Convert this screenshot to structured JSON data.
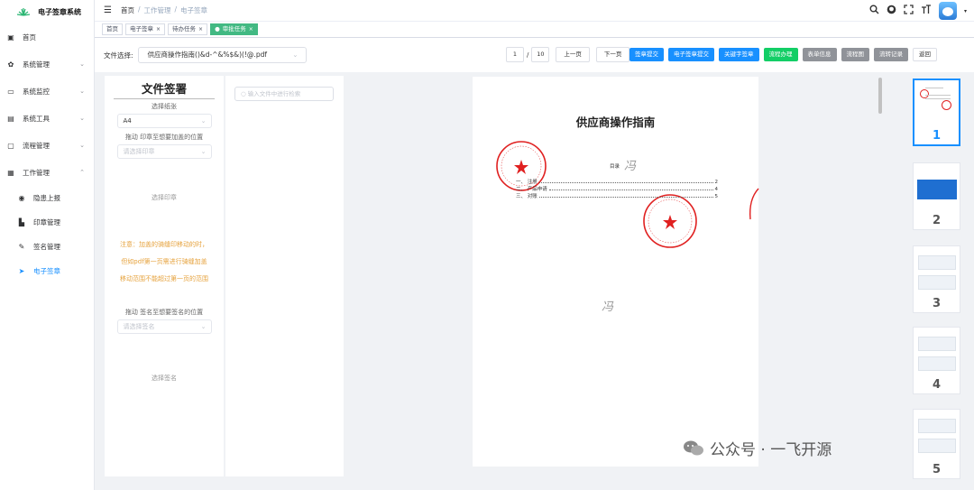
{
  "sidebar": {
    "brand": "电子签章系统",
    "items": [
      {
        "label": "首页",
        "icon": "dashboard-icon"
      },
      {
        "label": "系统管理",
        "icon": "gear-icon",
        "arrow": "⌄"
      },
      {
        "label": "系统监控",
        "icon": "monitor-icon",
        "arrow": "⌄"
      },
      {
        "label": "系统工具",
        "icon": "tool-icon",
        "arrow": "⌄"
      },
      {
        "label": "流程管理",
        "icon": "flow-icon",
        "arrow": "⌄"
      },
      {
        "label": "工作管理",
        "icon": "work-icon",
        "arrow": "⌃"
      }
    ],
    "subitems": [
      {
        "label": "隐患上报",
        "icon": "report-icon"
      },
      {
        "label": "印章管理",
        "icon": "seal-icon"
      },
      {
        "label": "签名管理",
        "icon": "signature-icon"
      },
      {
        "label": "电子签章",
        "icon": "send-icon",
        "active": true
      }
    ]
  },
  "header": {
    "breadcrumb": [
      "首页",
      "/",
      "工作管理",
      "/",
      "电子签章"
    ]
  },
  "tags": [
    {
      "label": "首页",
      "active": false,
      "closable": false
    },
    {
      "label": "电子签章",
      "active": false,
      "closable": true
    },
    {
      "label": "待办任务",
      "active": false,
      "closable": true
    },
    {
      "label": "审批任务",
      "active": true,
      "closable": true
    }
  ],
  "toolbar": {
    "file_label": "文件选择:",
    "file_value": "供应商操作指南()&d-^&%$&)(!@.pdf",
    "page_current": "1",
    "page_sep": "/",
    "page_total": "10",
    "prev": "上一页",
    "next": "下一页",
    "buttons": [
      {
        "label": "签章提交",
        "style": "blue"
      },
      {
        "label": "电子签章提交",
        "style": "blue"
      },
      {
        "label": "关键字签章",
        "style": "blue"
      },
      {
        "label": "流程办理",
        "style": "green"
      },
      {
        "label": "表单信息",
        "style": "gray"
      },
      {
        "label": "流程图",
        "style": "gray"
      },
      {
        "label": "流转记录",
        "style": "gray"
      },
      {
        "label": "返回",
        "style": "white"
      }
    ]
  },
  "left_panel": {
    "title": "文件签署",
    "paper_label": "选择纸张",
    "paper_value": "A4",
    "seal_drag_label": "拖动 印章至想要加盖的位置",
    "seal_placeholder": "请选择印章",
    "seal_choose": "选择印章",
    "note_lines": [
      "注意：加盖的骑缝印移动的时，",
      "但如pdf第一页需进行骑缝加盖",
      "移动范围不能超过第一页的范围"
    ],
    "sign_drag_label": "拖动 签名至想要签名的位置",
    "sign_placeholder": "请选择签名",
    "sign_choose": "选择签名"
  },
  "mid_panel": {
    "search_placeholder": "输入文件中进行检索"
  },
  "document": {
    "title": "供应商操作指南",
    "toc_head": "目录",
    "toc": [
      {
        "label": "一、 注册",
        "page": "2"
      },
      {
        "label": "二、 产品申请",
        "page": "4"
      },
      {
        "label": "三、 对账",
        "page": "5"
      }
    ],
    "signature": "冯"
  },
  "thumbnails": [
    "1",
    "2",
    "3",
    "4",
    "5"
  ],
  "watermark": "公众号 · 一飞开源",
  "colors": {
    "primary": "#1890ff",
    "success": "#13ce66",
    "tag_active": "#42b983",
    "seal_red": "#e02020",
    "warning": "#e6a23c"
  }
}
